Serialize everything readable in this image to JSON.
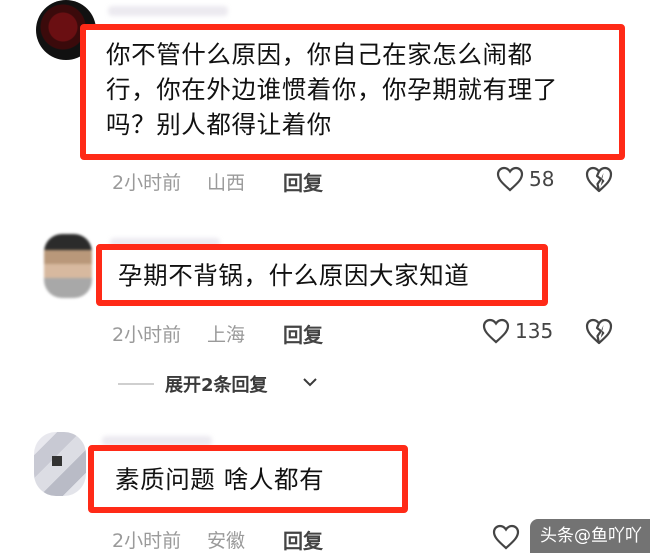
{
  "comments": [
    {
      "lines": [
        "你不管什么原因，你自己在家怎么闹都",
        "行，你在外边谁惯着你，你孕期就有理了",
        "吗？别人都得让着你"
      ],
      "time": "2小时前",
      "location": "山西",
      "reply_label": "回复",
      "likes": "58"
    },
    {
      "lines": [
        "孕期不背锅，什么原因大家知道"
      ],
      "time": "2小时前",
      "location": "上海",
      "reply_label": "回复",
      "likes": "135"
    },
    {
      "lines": [
        "素质问题  啥人都有"
      ],
      "time": "2小时前",
      "location": "安徽",
      "reply_label": "回复"
    }
  ],
  "expand_replies": "展开2条回复",
  "watermark": "头条@鱼吖吖",
  "colors": {
    "highlight_box": "#ff2a17",
    "meta_text": "#9a9a9a"
  }
}
